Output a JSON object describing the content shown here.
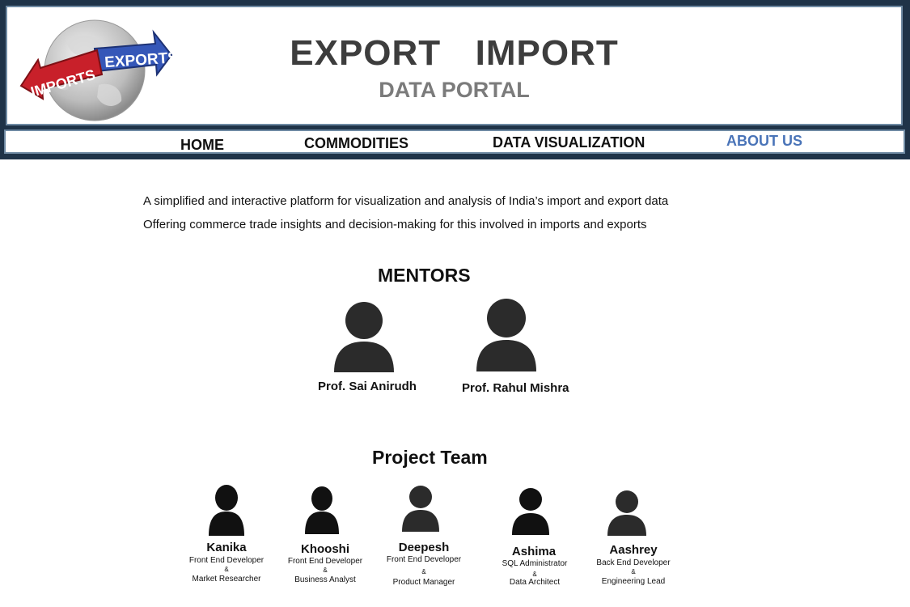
{
  "header": {
    "logo": {
      "icon": "globe-icon",
      "left_arrow_text": "IMPORTS",
      "right_arrow_text": "EXPORTS",
      "colors": {
        "imports": "#c8202a",
        "exports": "#3557b8",
        "globe": "#c4c4c4"
      }
    },
    "title": "EXPORT  IMPORT",
    "subtitle": "DATA PORTAL"
  },
  "nav": {
    "home": "HOME",
    "commodities": "COMMODITIES",
    "data_visualization": "DATA VISUALIZATION",
    "about_us": "ABOUT US",
    "active": "about_us",
    "active_color": "#4a74b8"
  },
  "intro": {
    "line1": "A simplified and interactive platform for visualization and analysis of India’s import and export data",
    "line2": "Offering commerce trade insights and decision-making for this involved in imports and exports"
  },
  "mentors": {
    "title": "MENTORS",
    "people": [
      {
        "name": "Prof. Sai Anirudh",
        "icon": "person-icon"
      },
      {
        "name": "Prof. Rahul Mishra",
        "icon": "person-icon"
      }
    ]
  },
  "team": {
    "title": "Project Team",
    "amp": "&",
    "members": [
      {
        "name": "Kanika",
        "role1": "Front End Developer",
        "role2": "Market Researcher",
        "icon": "person-icon"
      },
      {
        "name": "Khooshi",
        "role1": "Front End Developer",
        "role2": "Business Analyst",
        "icon": "person-icon"
      },
      {
        "name": "Deepesh",
        "role1": "Front End Developer",
        "role2": "Product Manager",
        "icon": "person-icon"
      },
      {
        "name": "Ashima",
        "role1": "SQL Administrator",
        "role2": "Data Architect",
        "icon": "person-icon"
      },
      {
        "name": "Aashrey",
        "role1": "Back End Developer",
        "role2": "Engineering Lead",
        "icon": "person-icon"
      }
    ]
  },
  "colors": {
    "header_band": "#1f3348",
    "box_border": "#6f8aa3",
    "title": "#3d3d3d",
    "subtitle": "#7b7b7b",
    "icon": "#2b2b2b"
  }
}
